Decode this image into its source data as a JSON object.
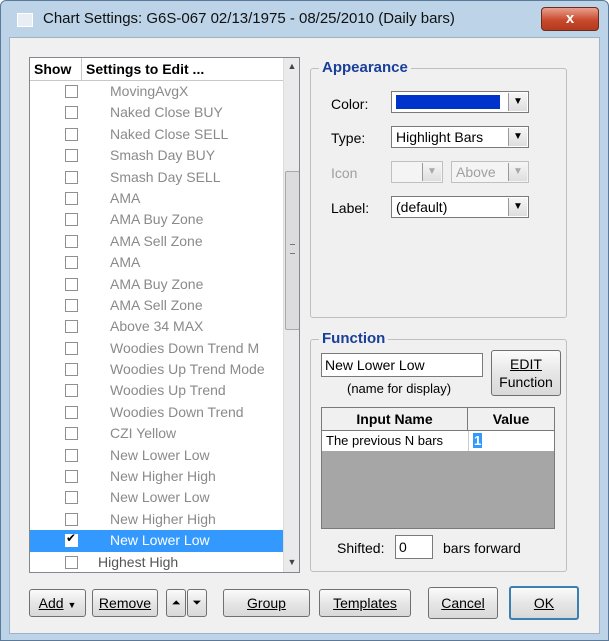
{
  "window": {
    "title": "Chart Settings:  G6S-067  02/13/1975 - 08/25/2010  (Daily bars)",
    "close_label": "x"
  },
  "list": {
    "header_show": "Show",
    "header_settings": "Settings to Edit ...",
    "items": [
      {
        "label": "MovingAvgX",
        "checked": false
      },
      {
        "label": "Naked Close BUY",
        "checked": false
      },
      {
        "label": "Naked Close SELL",
        "checked": false
      },
      {
        "label": "Smash Day BUY",
        "checked": false
      },
      {
        "label": "Smash Day SELL",
        "checked": false
      },
      {
        "label": "AMA",
        "checked": false
      },
      {
        "label": "AMA Buy Zone",
        "checked": false
      },
      {
        "label": "AMA Sell Zone",
        "checked": false
      },
      {
        "label": "AMA",
        "checked": false
      },
      {
        "label": "AMA Buy Zone",
        "checked": false
      },
      {
        "label": "AMA Sell Zone",
        "checked": false
      },
      {
        "label": "Above 34 MAX",
        "checked": false
      },
      {
        "label": "Woodies Down Trend M",
        "checked": false
      },
      {
        "label": "Woodies Up Trend Mode",
        "checked": false
      },
      {
        "label": "Woodies Up Trend",
        "checked": false
      },
      {
        "label": "Woodies Down Trend",
        "checked": false
      },
      {
        "label": "CZI Yellow",
        "checked": false
      },
      {
        "label": "New Lower Low",
        "checked": false
      },
      {
        "label": "New Higher High",
        "checked": false
      },
      {
        "label": "New Lower Low",
        "checked": false
      },
      {
        "label": "New Higher High",
        "checked": false
      },
      {
        "label": "New Lower Low",
        "checked": true,
        "selected": true
      },
      {
        "label": "Highest High",
        "checked": false
      }
    ]
  },
  "appearance": {
    "legend": "Appearance",
    "color_label": "Color:",
    "color_value": "#0033cc",
    "type_label": "Type:",
    "type_value": "Highlight Bars",
    "icon_label": "Icon",
    "icon_value": "",
    "icon_position": "Above",
    "label_label": "Label:",
    "label_value": "(default)"
  },
  "function": {
    "legend": "Function",
    "name_value": "New Lower Low",
    "name_caption": "(name for display)",
    "edit_line1": "EDIT",
    "edit_line2": "Function",
    "col_input": "Input Name",
    "col_value": "Value",
    "rows": [
      {
        "name": "The previous N bars",
        "value": "1"
      }
    ],
    "shifted_label": "Shifted:",
    "shifted_value": "0",
    "shifted_suffix": "bars forward"
  },
  "buttons": {
    "add": "Add",
    "remove": "Remove",
    "group": "Group",
    "templates": "Templates",
    "cancel": "Cancel",
    "ok": "OK"
  }
}
